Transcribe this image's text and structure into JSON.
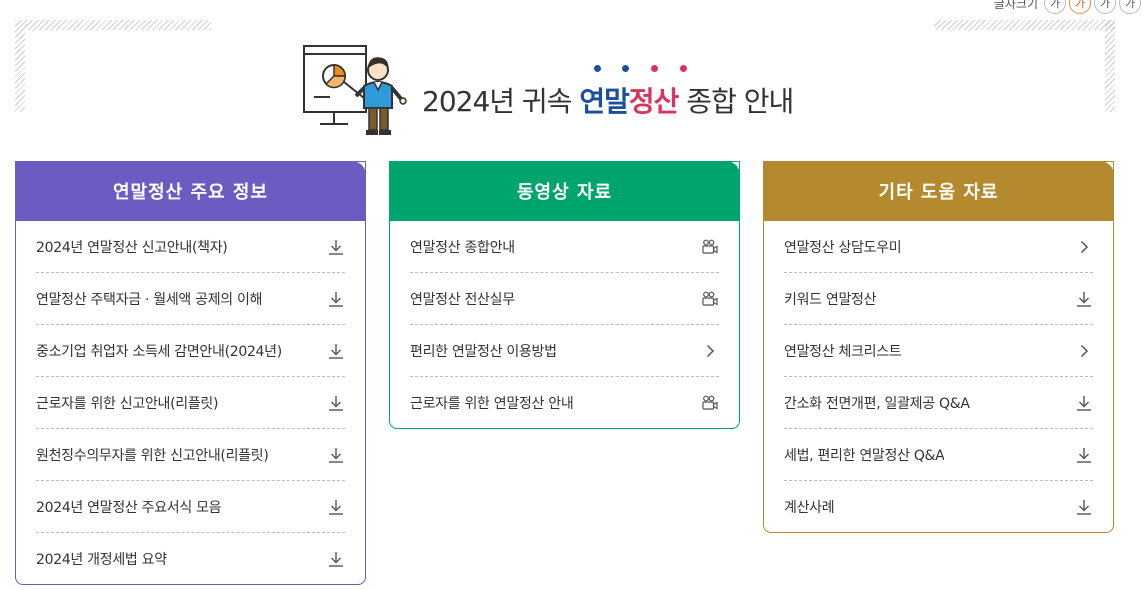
{
  "font_size_control": {
    "label": "글자크기",
    "buttons": [
      "가",
      "가",
      "가",
      "가"
    ]
  },
  "banner": {
    "title_prefix": "2024년 귀속 ",
    "title_blue": "연말",
    "title_red": "정산",
    "title_suffix": " 종합 안내",
    "dot_colors": [
      "#1b4f99",
      "#1b4f99",
      "#d8345f",
      "#d8345f"
    ]
  },
  "panels": [
    {
      "title": "연말정산 주요 정보",
      "color": "#6a5cc0",
      "items": [
        {
          "label": "2024년 연말정산 신고안내(책자)",
          "icon": "download-icon"
        },
        {
          "label": "연말정산 주택자금 · 월세액 공제의 이해",
          "icon": "download-icon"
        },
        {
          "label": "중소기업 취업자 소득세 감면안내(2024년)",
          "icon": "download-icon"
        },
        {
          "label": "근로자를 위한 신고안내(리플릿)",
          "icon": "download-icon"
        },
        {
          "label": "원천징수의무자를 위한 신고안내(리플릿)",
          "icon": "download-icon"
        },
        {
          "label": "2024년 연말정산 주요서식 모음",
          "icon": "download-icon"
        },
        {
          "label": "2024년 개정세법 요약",
          "icon": "download-icon"
        }
      ]
    },
    {
      "title": "동영상 자료",
      "color": "#00a56e",
      "items": [
        {
          "label": "연말정산 종합안내",
          "icon": "video-camera-icon"
        },
        {
          "label": "연말정산 전산실무",
          "icon": "video-camera-icon"
        },
        {
          "label": "편리한 연말정산 이용방법",
          "icon": "chevron-right-icon"
        },
        {
          "label": "근로자를 위한 연말정산 안내",
          "icon": "video-camera-icon"
        }
      ]
    },
    {
      "title": "기타 도움 자료",
      "color": "#b5892e",
      "items": [
        {
          "label": "연말정산 상담도우미",
          "icon": "chevron-right-icon"
        },
        {
          "label": "키워드 연말정산",
          "icon": "download-icon"
        },
        {
          "label": "연말정산 체크리스트",
          "icon": "chevron-right-icon"
        },
        {
          "label": "간소화 전면개편, 일괄제공 Q&A",
          "icon": "download-icon"
        },
        {
          "label": "세법, 편리한 연말정산 Q&A",
          "icon": "download-icon"
        },
        {
          "label": "계산사례",
          "icon": "download-icon"
        }
      ]
    }
  ]
}
